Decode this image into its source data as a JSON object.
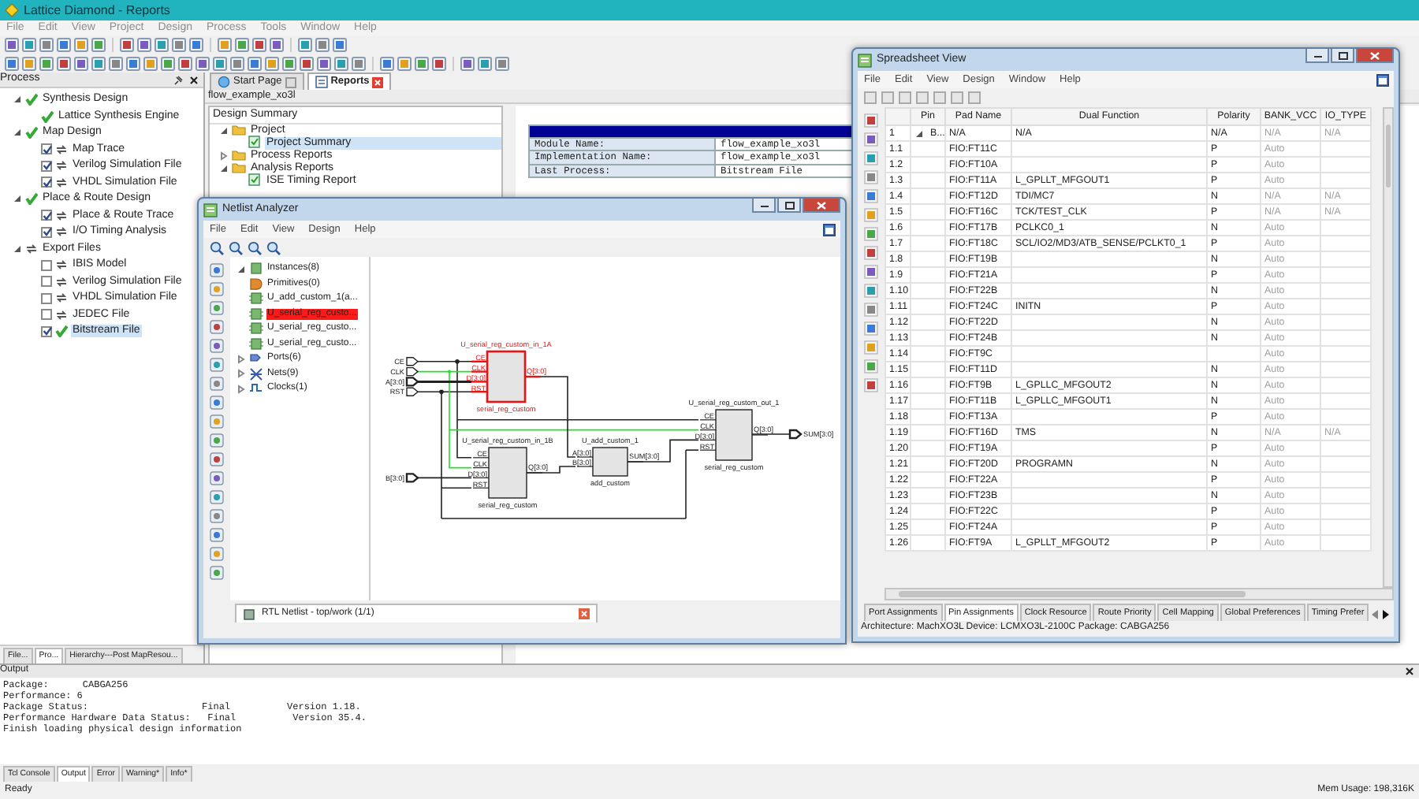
{
  "window": {
    "title": "Lattice Diamond - Reports"
  },
  "menu": [
    "File",
    "Edit",
    "View",
    "Project",
    "Design",
    "Process",
    "Tools",
    "Window",
    "Help"
  ],
  "process_panel": {
    "title": "Process",
    "tree": [
      {
        "label": "Synthesis Design",
        "kind": "done",
        "expanded": true,
        "selected": false,
        "children": [
          {
            "label": "Lattice Synthesis Engine",
            "kind": "done",
            "selected": false
          }
        ]
      },
      {
        "label": "Map Design",
        "kind": "done",
        "expanded": true,
        "selected": false,
        "children": [
          {
            "label": "Map Trace",
            "kind": "pending",
            "checked": true,
            "selected": false
          },
          {
            "label": "Verilog Simulation File",
            "kind": "pending",
            "checked": true,
            "selected": false
          },
          {
            "label": "VHDL Simulation File",
            "kind": "pending",
            "checked": true,
            "selected": false
          }
        ]
      },
      {
        "label": "Place & Route Design",
        "kind": "done",
        "expanded": true,
        "selected": false,
        "children": [
          {
            "label": "Place & Route Trace",
            "kind": "pending",
            "checked": true,
            "selected": false
          },
          {
            "label": "I/O Timing Analysis",
            "kind": "pending",
            "checked": true,
            "selected": false
          }
        ]
      },
      {
        "label": "Export Files",
        "kind": "pending",
        "expanded": true,
        "selected": false,
        "children": [
          {
            "label": "IBIS Model",
            "kind": "pending",
            "checked": false,
            "selected": false
          },
          {
            "label": "Verilog Simulation File",
            "kind": "pending",
            "checked": false,
            "selected": false
          },
          {
            "label": "VHDL Simulation File",
            "kind": "pending",
            "checked": false,
            "selected": false
          },
          {
            "label": "JEDEC File",
            "kind": "pending",
            "checked": false,
            "selected": false
          },
          {
            "label": "Bitstream File",
            "kind": "done",
            "checked": true,
            "selected": true
          }
        ]
      }
    ]
  },
  "left_tabs": [
    {
      "label": "File...",
      "selected": false
    },
    {
      "label": "Pro...",
      "selected": true
    },
    {
      "label": "Hierarchy---Post MapResou...",
      "selected": false
    }
  ],
  "doc_tabs": [
    {
      "label": "Start Page",
      "selected": false
    },
    {
      "label": "Reports",
      "selected": true
    }
  ],
  "report": {
    "path": "flow_example_xo3l",
    "summary_title": "Design Summary",
    "tree": [
      {
        "label": "Project",
        "kind": "folder",
        "expanded": true,
        "selected": false,
        "children": [
          {
            "label": "Project Summary",
            "kind": "report",
            "selected": true
          }
        ]
      },
      {
        "label": "Process Reports",
        "kind": "folder",
        "expanded": false,
        "selected": false
      },
      {
        "label": "Analysis Reports",
        "kind": "folder",
        "expanded": true,
        "selected": false,
        "children": [
          {
            "label": "ISE Timing Report",
            "kind": "report",
            "selected": false
          }
        ]
      }
    ],
    "table": [
      {
        "label": "Module Name:",
        "value": "flow_example_xo3l"
      },
      {
        "label": "Implementation Name:",
        "value": "flow_example_xo3l"
      },
      {
        "label": "Last Process:",
        "value": "Bitstream File"
      }
    ]
  },
  "netlist": {
    "title": "Netlist Analyzer",
    "menu": [
      "File",
      "Edit",
      "View",
      "Design",
      "Help"
    ],
    "tree": [
      {
        "label": "Instances(8)",
        "kind": "instances",
        "expanded": true,
        "selected": false,
        "children": [
          {
            "label": "Primitives(0)",
            "kind": "primitive",
            "selected": false
          },
          {
            "label": "U_add_custom_1(a...",
            "kind": "instance",
            "selected": false
          },
          {
            "label": "U_serial_reg_custo...",
            "kind": "instance",
            "selected": true
          },
          {
            "label": "U_serial_reg_custo...",
            "kind": "instance",
            "selected": false
          },
          {
            "label": "U_serial_reg_custo...",
            "kind": "instance",
            "selected": false
          }
        ]
      },
      {
        "label": "Ports(6)",
        "kind": "ports",
        "expanded": false,
        "selected": false
      },
      {
        "label": "Nets(9)",
        "kind": "nets",
        "expanded": false,
        "selected": false
      },
      {
        "label": "Clocks(1)",
        "kind": "clocks",
        "expanded": false,
        "selected": false
      }
    ],
    "schematic": {
      "inputs": [
        "CE",
        "CLK",
        "A[3:0]",
        "RST",
        "B[3:0]"
      ],
      "outputs": [
        "SUM[3:0]"
      ],
      "blocks": [
        {
          "instance": "U_serial_reg_custom_in_1A",
          "cell": "serial_reg_custom",
          "pins_in": [
            "CE",
            "CLK",
            "D[3:0]",
            "RST"
          ],
          "pins_out": [
            "Q[3:0]"
          ],
          "selected": true
        },
        {
          "instance": "U_serial_reg_custom_in_1B",
          "cell": "serial_reg_custom",
          "pins_in": [
            "CE",
            "CLK",
            "D[3:0]",
            "RST"
          ],
          "pins_out": [
            "Q[3:0]"
          ],
          "selected": false
        },
        {
          "instance": "U_add_custom_1",
          "cell": "add_custom",
          "pins_in": [
            "A[3:0]",
            "B[3:0]"
          ],
          "pins_out": [
            "SUM[3:0]"
          ],
          "selected": false
        },
        {
          "instance": "U_serial_reg_custom_out_1",
          "cell": "serial_reg_custom",
          "pins_in": [
            "CE",
            "CLK",
            "D[3:0]",
            "RST"
          ],
          "pins_out": [
            "Q[3:0]"
          ],
          "selected": false
        }
      ]
    },
    "tab": "RTL Netlist - top/work (1/1)"
  },
  "spreadsheet": {
    "title": "Spreadsheet View",
    "menu": [
      "File",
      "Edit",
      "View",
      "Design",
      "Window",
      "Help"
    ],
    "columns": [
      "Pin",
      "Pad Name",
      "Dual Function",
      "Polarity",
      "BANK_VCC",
      "IO_TYPE"
    ],
    "rows": [
      {
        "kind": "group",
        "index": "1",
        "pin": "B...",
        "expanded": true,
        "pad": "N/A",
        "dual": "N/A",
        "polarity": "N/A",
        "bank_vcc": "N/A",
        "io_type": "N/A"
      },
      {
        "kind": "pin",
        "index": "1.1",
        "pad": "FIO:FT11C",
        "polarity": "P",
        "bank_vcc": "Auto"
      },
      {
        "kind": "pin",
        "index": "1.2",
        "pad": "FIO:FT10A",
        "polarity": "P",
        "bank_vcc": "Auto"
      },
      {
        "kind": "pin",
        "index": "1.3",
        "pad": "FIO:FT11A",
        "dual": "L_GPLLT_MFGOUT1",
        "polarity": "P",
        "bank_vcc": "Auto"
      },
      {
        "kind": "pin",
        "index": "1.4",
        "pad": "FIO:FT12D",
        "dual": "TDI/MC7",
        "polarity": "N",
        "bank_vcc": "N/A",
        "io_type": "N/A"
      },
      {
        "kind": "pin",
        "index": "1.5",
        "pad": "FIO:FT16C",
        "dual": "TCK/TEST_CLK",
        "polarity": "P",
        "bank_vcc": "N/A",
        "io_type": "N/A"
      },
      {
        "kind": "pin",
        "index": "1.6",
        "pad": "FIO:FT17B",
        "dual": "PCLKC0_1",
        "polarity": "N",
        "bank_vcc": "Auto"
      },
      {
        "kind": "pin",
        "index": "1.7",
        "pad": "FIO:FT18C",
        "dual": "SCL/IO2/MD3/ATB_SENSE/PCLKT0_1",
        "polarity": "P",
        "bank_vcc": "Auto"
      },
      {
        "kind": "pin",
        "index": "1.8",
        "pad": "FIO:FT19B",
        "polarity": "N",
        "bank_vcc": "Auto"
      },
      {
        "kind": "pin",
        "index": "1.9",
        "pad": "FIO:FT21A",
        "polarity": "P",
        "bank_vcc": "Auto"
      },
      {
        "kind": "pin",
        "index": "1.10",
        "pad": "FIO:FT22B",
        "polarity": "N",
        "bank_vcc": "Auto"
      },
      {
        "kind": "pin",
        "index": "1.11",
        "pad": "FIO:FT24C",
        "dual": "INITN",
        "polarity": "P",
        "bank_vcc": "Auto"
      },
      {
        "kind": "pin",
        "index": "1.12",
        "pad": "FIO:FT22D",
        "polarity": "N",
        "bank_vcc": "Auto"
      },
      {
        "kind": "pin",
        "index": "1.13",
        "pad": "FIO:FT24B",
        "polarity": "N",
        "bank_vcc": "Auto"
      },
      {
        "kind": "pin",
        "index": "1.14",
        "pad": "FIO:FT9C",
        "bank_vcc": "Auto"
      },
      {
        "kind": "pin",
        "index": "1.15",
        "pad": "FIO:FT11D",
        "polarity": "N",
        "bank_vcc": "Auto"
      },
      {
        "kind": "pin",
        "index": "1.16",
        "pad": "FIO:FT9B",
        "dual": "L_GPLLC_MFGOUT2",
        "polarity": "N",
        "bank_vcc": "Auto"
      },
      {
        "kind": "pin",
        "index": "1.17",
        "pad": "FIO:FT11B",
        "dual": "L_GPLLC_MFGOUT1",
        "polarity": "N",
        "bank_vcc": "Auto"
      },
      {
        "kind": "pin",
        "index": "1.18",
        "pad": "FIO:FT13A",
        "polarity": "P",
        "bank_vcc": "Auto"
      },
      {
        "kind": "pin",
        "index": "1.19",
        "pad": "FIO:FT16D",
        "dual": "TMS",
        "polarity": "N",
        "bank_vcc": "N/A",
        "io_type": "N/A"
      },
      {
        "kind": "pin",
        "index": "1.20",
        "pad": "FIO:FT19A",
        "polarity": "P",
        "bank_vcc": "Auto"
      },
      {
        "kind": "pin",
        "index": "1.21",
        "pad": "FIO:FT20D",
        "dual": "PROGRAMN",
        "polarity": "N",
        "bank_vcc": "Auto"
      },
      {
        "kind": "pin",
        "index": "1.22",
        "pad": "FIO:FT22A",
        "polarity": "P",
        "bank_vcc": "Auto"
      },
      {
        "kind": "pin",
        "index": "1.23",
        "pad": "FIO:FT23B",
        "polarity": "N",
        "bank_vcc": "Auto"
      },
      {
        "kind": "pin",
        "index": "1.24",
        "pad": "FIO:FT22C",
        "polarity": "P",
        "bank_vcc": "Auto"
      },
      {
        "kind": "pin",
        "index": "1.25",
        "pad": "FIO:FT24A",
        "polarity": "P",
        "bank_vcc": "Auto"
      },
      {
        "kind": "pin",
        "index": "1.26",
        "pad": "FIO:FT9A",
        "dual": "L_GPLLT_MFGOUT2",
        "polarity": "P",
        "bank_vcc": "Auto"
      }
    ],
    "tabs": [
      {
        "label": "Port Assignments",
        "selected": false
      },
      {
        "label": "Pin Assignments",
        "selected": true
      },
      {
        "label": "Clock Resource",
        "selected": false
      },
      {
        "label": "Route Priority",
        "selected": false
      },
      {
        "label": "Cell Mapping",
        "selected": false
      },
      {
        "label": "Global Preferences",
        "selected": false
      },
      {
        "label": "Timing Prefer",
        "selected": false
      }
    ],
    "status": "Architecture: MachXO3L  Device: LCMXO3L-2100C  Package: CABGA256"
  },
  "output": {
    "title": "Output",
    "lines": [
      "Package:      CABGA256",
      "Performance: 6",
      "Package Status:                    Final          Version 1.18.",
      "Performance Hardware Data Status:   Final          Version 35.4.",
      "Finish loading physical design information"
    ],
    "tabs": [
      {
        "label": "Tcl Console",
        "selected": false
      },
      {
        "label": "Output",
        "selected": true
      },
      {
        "label": "Error",
        "selected": false
      },
      {
        "label": "Warning*",
        "selected": false
      },
      {
        "label": "Info*",
        "selected": false
      }
    ]
  },
  "status_bar": {
    "message": "Ready",
    "memory": "Mem Usage: 198,316K"
  }
}
